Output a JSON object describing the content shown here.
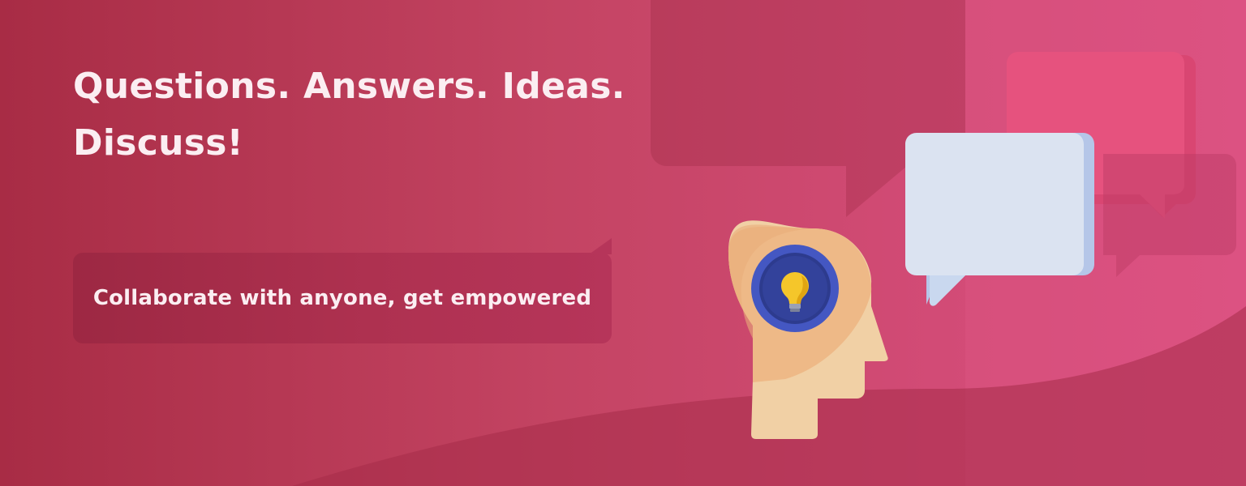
{
  "headline": {
    "line1": "Questions. Answers. Ideas.",
    "line2": "Discuss!"
  },
  "tagline": {
    "text": "Collaborate with anyone, get empowered"
  },
  "colors": {
    "background_start": "#a82c45",
    "background_end": "#da4f7f",
    "headline_text": "#fbeef2",
    "tagline_bubble": "#ae3150",
    "speech_bubble_front": "#dbe3f1",
    "speech_bubble_back": "#e6527e",
    "head": "#f1d0a5",
    "head_shadow": "#eeb987",
    "lightbulb": "#f5c62a",
    "bulb_ring": "#4457c2"
  },
  "icons": {
    "head": "head-silhouette-icon",
    "lightbulb": "lightbulb-icon",
    "speech_front": "speech-bubble-icon",
    "speech_back": "speech-bubble-back-icon"
  }
}
